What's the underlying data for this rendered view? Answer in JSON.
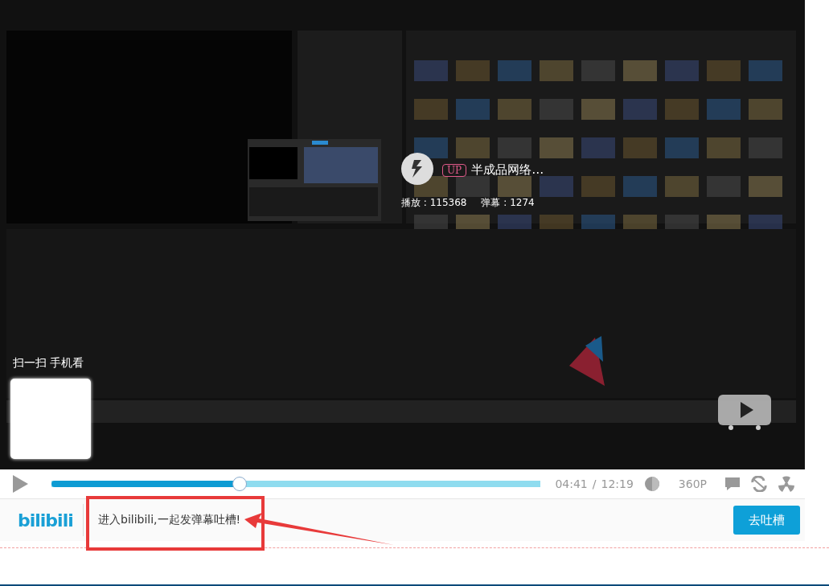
{
  "uploader_card": {
    "badge": "UP",
    "name": "半成品网络…",
    "plays": "播放 : 115368",
    "danmaku": "弹幕 : 1274"
  },
  "qr": {
    "label": "扫一扫 手机看"
  },
  "controls": {
    "progress": {
      "level": 0.384
    },
    "time_current": "04:41",
    "time_separator": "/",
    "time_total": "12:19",
    "quality": "360P"
  },
  "bottom_bar": {
    "logo": "bilibili",
    "prompt": "进入bilibili,一起发弹幕吐槽!",
    "button": "去吐槽"
  }
}
